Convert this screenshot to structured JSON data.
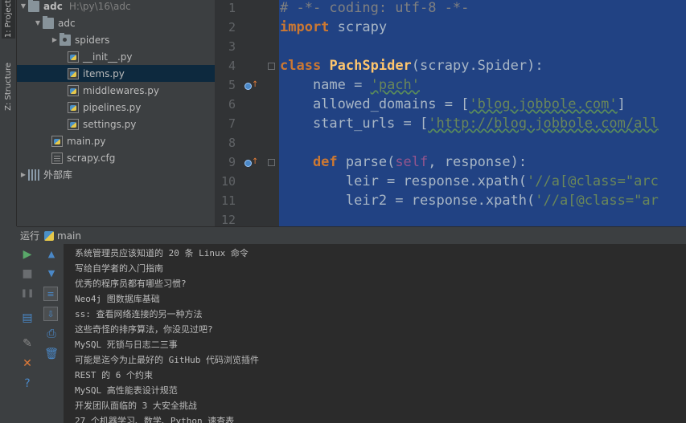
{
  "left_tabs": [
    {
      "label": "1: Project",
      "icon": "folder-icon"
    },
    {
      "label": "Z: Structure",
      "icon": "structure-icon"
    }
  ],
  "project_tree": [
    {
      "label": "adc",
      "path": "H:\\py\\16\\adc",
      "type": "root",
      "arrow": "▼"
    },
    {
      "label": "adc",
      "type": "folder",
      "arrow": "▼"
    },
    {
      "label": "spiders",
      "type": "package",
      "arrow": "▶"
    },
    {
      "label": "__init__.py",
      "type": "py"
    },
    {
      "label": "items.py",
      "type": "py",
      "selected": true
    },
    {
      "label": "middlewares.py",
      "type": "py"
    },
    {
      "label": "pipelines.py",
      "type": "py"
    },
    {
      "label": "settings.py",
      "type": "py"
    },
    {
      "label": "main.py",
      "type": "py"
    },
    {
      "label": "scrapy.cfg",
      "type": "cfg"
    },
    {
      "label": "外部库",
      "type": "libs",
      "arrow": "▶"
    }
  ],
  "editor": {
    "line_numbers": [
      "1",
      "2",
      "3",
      "4",
      "5",
      "6",
      "7",
      "8",
      "9",
      "10",
      "11",
      "12"
    ],
    "lines": {
      "l1": "# -*- coding: utf-8 -*-",
      "l2_kw": "import",
      "l2_rest": " scrapy",
      "l4_kw": "class",
      "l4_cls": "PachSpider",
      "l4_rest": "(scrapy.Spider):",
      "l5_a": "    name = ",
      "l5_str": "'pach'",
      "l6_a": "    allowed_domains = [",
      "l6_str": "'blog.jobbole.com'",
      "l6_b": "]",
      "l7_a": "    start_urls = [",
      "l7_str": "'http://blog.jobbole.com/all",
      "l9_kw": "    def",
      "l9_fn": " parse(",
      "l9_self": "self",
      "l9_b": ", response):",
      "l10_a": "        leir = response.xpath(",
      "l10_str": "'//a[@class=\"arc",
      "l11_a": "        leir2 = response.xpath(",
      "l11_str": "'//a[@class=\"ar"
    }
  },
  "run_panel": {
    "title": "运行",
    "config": "main"
  },
  "console_lines": [
    "系统管理员应该知道的 20 条 Linux 命令",
    "写给自学者的入门指南",
    "优秀的程序员都有哪些习惯?",
    "Neo4j 图数据库基础",
    "ss: 查看网络连接的另一种方法",
    "这些奇怪的排序算法，你没见过吧?",
    "MySQL 死锁与日志二三事",
    "可能是迄今为止最好的 GitHub 代码浏览插件",
    "REST 的 6 个约束",
    "MySQL 高性能表设计规范",
    "开发团队面临的 3 大安全挑战",
    "27 个机器学习、数学、Python 速查表"
  ],
  "run_toolbar": {
    "run": "▶",
    "stop": "■",
    "pause": "❚❚",
    "up": "▲",
    "down": "▼",
    "help": "?",
    "close": "✕"
  }
}
